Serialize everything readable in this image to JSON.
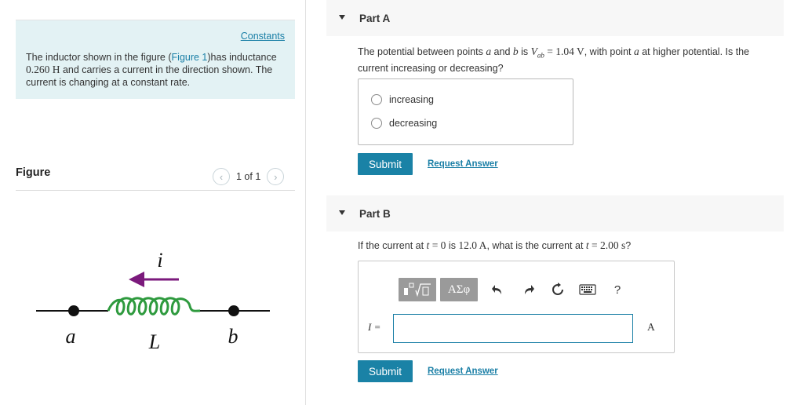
{
  "constants": {
    "link_label": "Constants",
    "text_before_link": "The inductor shown in the figure (",
    "figure_link": "Figure 1",
    "text_after_link": ")has inductance ",
    "inductance_value": "0.260 H",
    "text_tail": " and carries a current in the direction shown. The current is changing at a constant rate."
  },
  "figure": {
    "title": "Figure",
    "pager_text": "1 of 1",
    "label_current": "i",
    "label_a": "a",
    "label_b": "b",
    "label_inductor": "L"
  },
  "part_a": {
    "title": "Part A",
    "question_1": "The potential between points ",
    "question_a": "a",
    "question_2": " and ",
    "question_b": "b",
    "question_3": " is ",
    "question_v": "V",
    "question_sub": "ab",
    "question_value": " = 1.04 V",
    "question_4": ", with point ",
    "question_a2": "a",
    "question_5": " at higher potential. Is the current increasing or decreasing?",
    "options": [
      "increasing",
      "decreasing"
    ],
    "submit_label": "Submit",
    "request_label": "Request Answer"
  },
  "part_b": {
    "title": "Part B",
    "question_1": "If the current at ",
    "question_t1": "t",
    "question_2": " = 0",
    "question_3": " is ",
    "question_i": "12.0 A",
    "question_4": ", what is the current at ",
    "question_t2": "t",
    "question_5": " = 2.00 s",
    "question_6": "?",
    "toolbar": {
      "greek_label": "ΑΣφ",
      "help_label": "?"
    },
    "input_label": "I =",
    "unit": "A",
    "submit_label": "Submit",
    "request_label": "Request Answer"
  },
  "colors": {
    "accent": "#1a82a6",
    "inductor": "#2e9a3e",
    "arrow": "#7b1a7c",
    "panel": "#e3f2f4"
  }
}
